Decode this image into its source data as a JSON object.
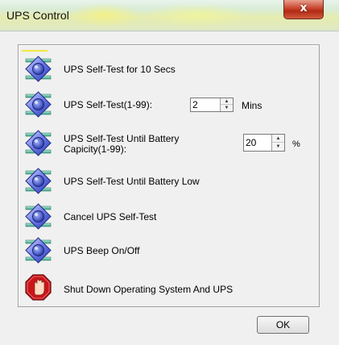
{
  "window": {
    "title": "UPS Control",
    "close_label": "x"
  },
  "actions": [
    {
      "label": "UPS Self-Test for 10 Secs",
      "icon": "diamond-icon"
    },
    {
      "label": "UPS Self-Test(1-99):",
      "icon": "diamond-icon",
      "value": "2",
      "unit": "Mins"
    },
    {
      "label_line1": "UPS Self-Test Until Battery",
      "label_line2": "Capicity(1-99):",
      "icon": "diamond-icon",
      "value": "20",
      "unit": "%"
    },
    {
      "label": "UPS Self-Test Until Battery Low",
      "icon": "diamond-icon"
    },
    {
      "label": "Cancel UPS Self-Test",
      "icon": "diamond-icon"
    },
    {
      "label": "UPS Beep On/Off",
      "icon": "diamond-icon"
    },
    {
      "label": "Shut Down Operating System And UPS",
      "icon": "stop-hand-icon"
    }
  ],
  "footer": {
    "ok_label": "OK"
  }
}
